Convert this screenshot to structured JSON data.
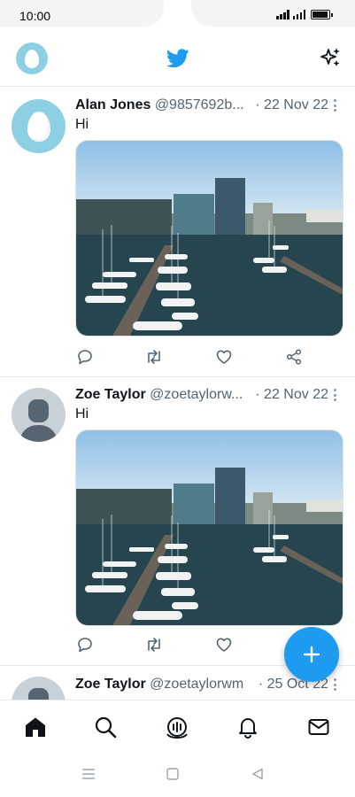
{
  "status_bar": {
    "time": "10:00"
  },
  "app_bar": {
    "logo_icon": "twitter-bird-icon",
    "right_icon": "sparkle-icon"
  },
  "colors": {
    "brand": "#1d9bf0",
    "text": "#0f1419",
    "secondary_text": "#536471",
    "egg_avatar_bg": "#8ed0e3"
  },
  "tweets": [
    {
      "name": "Alan Jones",
      "handle": "@9857692b...",
      "time": "· 22 Nov 22",
      "text": "Hi"
    },
    {
      "name": "Zoe Taylor",
      "handle": "@zoetaylorw...",
      "time": "· 22 Nov 22",
      "text": "Hi"
    },
    {
      "name": "Zoe Taylor",
      "handle": "@zoetaylorwm",
      "time": "· 25 Oct 22",
      "text": ""
    }
  ],
  "bottom_nav": [
    "home-icon",
    "search-icon",
    "spaces-icon",
    "notifications-icon",
    "messages-icon"
  ],
  "system_nav": [
    "menu-icon",
    "home-square-icon",
    "back-icon"
  ]
}
